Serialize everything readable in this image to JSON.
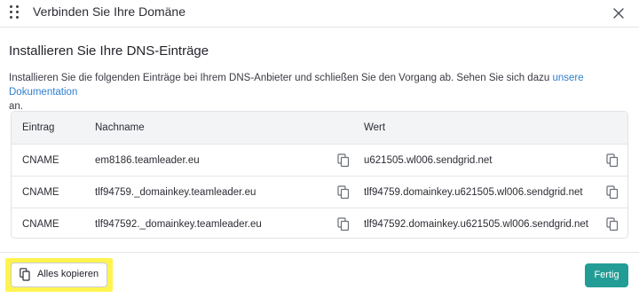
{
  "dialog": {
    "title": "Verbinden Sie Ihre Domäne",
    "drag_icon": "drag-handle-icon",
    "close_icon": "close-icon"
  },
  "section": {
    "title": "Installieren Sie Ihre DNS-Einträge",
    "intro_text": "Installieren Sie die folgenden Einträge bei Ihrem DNS-Anbieter und schließen Sie den Vorgang ab. Sehen Sie sich dazu ",
    "doc_link": "unsere Dokumentation",
    "intro_end": "an."
  },
  "table": {
    "headers": {
      "type": "Eintrag",
      "name": "Nachname",
      "value": "Wert"
    },
    "rows": [
      {
        "type": "CNAME",
        "name": "em8186.teamleader.eu",
        "value": "u621505.wl006.sendgrid.net"
      },
      {
        "type": "CNAME",
        "name": "tlf94759._domainkey.teamleader.eu",
        "value": "tlf94759.domainkey.u621505.wl006.sendgrid.net"
      },
      {
        "type": "CNAME",
        "name": "tlf947592._domainkey.teamleader.eu",
        "value": "tlf947592.domainkey.u621505.wl006.sendgrid.net"
      }
    ],
    "copy_icon": "copy-icon"
  },
  "footer": {
    "copy_all_label": "Alles kopieren",
    "done_label": "Fertig"
  },
  "colors": {
    "accent": "#229d96",
    "link": "#2f7fd1",
    "highlight": "#fff44f"
  }
}
